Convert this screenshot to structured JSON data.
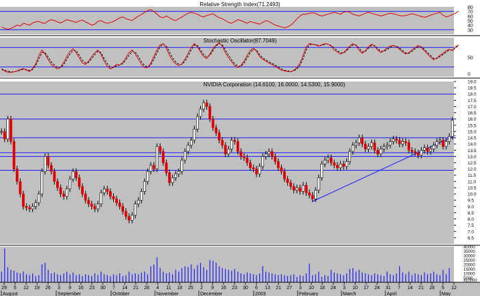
{
  "chart_data": [
    {
      "type": "line",
      "title": "Relative Strength Index(71.2493)",
      "ylim": [
        20,
        80
      ],
      "yticks": [
        30,
        40,
        50,
        60,
        70,
        80
      ],
      "hlines": [
        30,
        70
      ],
      "series": [
        {
          "values": [
            36,
            33,
            31,
            33,
            36,
            40,
            38,
            44,
            42,
            40,
            45,
            47,
            48,
            45,
            44,
            49,
            52,
            50,
            47,
            45,
            48,
            52,
            50,
            48,
            46,
            49,
            51,
            47,
            44,
            40,
            42,
            48,
            50,
            46,
            44,
            46,
            48,
            52,
            56,
            58,
            54,
            52,
            50,
            55,
            60,
            63,
            68,
            72,
            74,
            70,
            64,
            58,
            56,
            60,
            56,
            52,
            50,
            54,
            58,
            62,
            66,
            68,
            66,
            64,
            60,
            58,
            61,
            63,
            65,
            60,
            56,
            54,
            50,
            46,
            44,
            48,
            52,
            50,
            47,
            44,
            48,
            46,
            44,
            42,
            46,
            50,
            48,
            44,
            40,
            38,
            36,
            34,
            36,
            40,
            46,
            54,
            60,
            64,
            64,
            66,
            67,
            66,
            62,
            60,
            62,
            64,
            66,
            68,
            66,
            64,
            68,
            70,
            68,
            64,
            62,
            60,
            63,
            66,
            68,
            66,
            64,
            62,
            60,
            62,
            64,
            66,
            65,
            63,
            61,
            60,
            61,
            63,
            65,
            63,
            61,
            59,
            57,
            59,
            62,
            64,
            66,
            68,
            62,
            58,
            60,
            63,
            66,
            71
          ]
        }
      ]
    },
    {
      "type": "line",
      "title": "Stochastic Oscillator(87.7049)",
      "ylim": [
        -10,
        110
      ],
      "yticks": [
        0,
        50
      ],
      "hlines": [
        20,
        80
      ],
      "series": [
        {
          "values": [
            12,
            8,
            4,
            3,
            5,
            8,
            12,
            15,
            10,
            6,
            15,
            30,
            55,
            72,
            60,
            42,
            28,
            20,
            14,
            20,
            34,
            52,
            68,
            76,
            64,
            48,
            32,
            28,
            38,
            52,
            64,
            72,
            58,
            38,
            22,
            14,
            20,
            28,
            26,
            34,
            48,
            64,
            72,
            60,
            44,
            28,
            18,
            18,
            32,
            52,
            72,
            88,
            92,
            78,
            56,
            40,
            30,
            24,
            30,
            44,
            62,
            80,
            92,
            82,
            66,
            52,
            46,
            60,
            76,
            88,
            94,
            84,
            64,
            48,
            36,
            24,
            18,
            24,
            38,
            56,
            70,
            78,
            68,
            52,
            44,
            38,
            32,
            28,
            22,
            16,
            10,
            8,
            6,
            5,
            10,
            18,
            32,
            56,
            82,
            92,
            90,
            88,
            84,
            88,
            92,
            90,
            84,
            72,
            66,
            60,
            64,
            74,
            84,
            92,
            86,
            72,
            62,
            70,
            82,
            90,
            84,
            72,
            64,
            70,
            78,
            84,
            86,
            82,
            74,
            66,
            60,
            64,
            72,
            80,
            86,
            80,
            70,
            60,
            50,
            42,
            48,
            56,
            62,
            70,
            74,
            70,
            82,
            88
          ]
        },
        {
          "values": [
            14,
            10,
            7,
            5,
            5,
            7,
            10,
            13,
            12,
            9,
            12,
            25,
            45,
            64,
            64,
            50,
            36,
            26,
            18,
            18,
            28,
            44,
            60,
            72,
            70,
            56,
            40,
            32,
            34,
            46,
            58,
            68,
            64,
            46,
            30,
            20,
            18,
            24,
            26,
            30,
            42,
            56,
            68,
            66,
            52,
            36,
            24,
            20,
            26,
            44,
            64,
            82,
            90,
            84,
            66,
            48,
            36,
            28,
            28,
            38,
            54,
            72,
            88,
            86,
            72,
            58,
            50,
            56,
            70,
            84,
            92,
            88,
            72,
            56,
            42,
            30,
            22,
            22,
            32,
            48,
            64,
            74,
            72,
            58,
            48,
            42,
            36,
            31,
            26,
            20,
            14,
            10,
            8,
            6,
            8,
            14,
            26,
            46,
            72,
            88,
            90,
            89,
            86,
            86,
            90,
            90,
            86,
            78,
            70,
            64,
            63,
            70,
            80,
            88,
            88,
            78,
            66,
            68,
            78,
            86,
            86,
            76,
            68,
            68,
            74,
            80,
            85,
            84,
            78,
            70,
            63,
            62,
            68,
            76,
            82,
            82,
            74,
            64,
            55,
            46,
            46,
            52,
            58,
            66,
            72,
            72,
            78,
            86
          ]
        }
      ]
    },
    {
      "type": "candlestick",
      "title": "NVIDIA Corporation (14.6100, 16.0000, 14.5300, 15.9000)",
      "ylim": [
        6,
        19
      ],
      "yticks": [
        6.5,
        7.0,
        7.5,
        8.0,
        8.5,
        9.0,
        9.5,
        10.0,
        10.5,
        11.0,
        11.5,
        12.0,
        12.5,
        13.0,
        13.5,
        14.0,
        14.5,
        15.0,
        15.5,
        16.0,
        16.5,
        17.0,
        17.5,
        18.0,
        18.5,
        19.0
      ],
      "hlines": [
        18.0,
        16.0,
        14.5,
        13.3,
        13.0,
        11.9
      ],
      "trendline": {
        "x_start": 100,
        "y_start": 9.4,
        "x_end": 146,
        "y_end": 14.7
      },
      "close": [
        15.0,
        14.4,
        16.0,
        14.2,
        12.0,
        11.0,
        10.0,
        9.0,
        8.9,
        8.8,
        9.0,
        9.3,
        10.0,
        11.8,
        13.0,
        12.3,
        11.8,
        11.0,
        10.5,
        10.0,
        9.8,
        10.4,
        11.2,
        11.8,
        11.3,
        10.6,
        10.0,
        9.5,
        9.2,
        9.0,
        8.8,
        9.2,
        10.1,
        10.4,
        10.2,
        9.8,
        9.6,
        9.3,
        9.0,
        8.6,
        8.2,
        7.9,
        8.3,
        9.2,
        9.5,
        10.2,
        11.0,
        11.8,
        12.3,
        12.0,
        13.8,
        13.4,
        12.5,
        11.7,
        10.9,
        11.3,
        11.6,
        11.8,
        12.7,
        13.4,
        13.9,
        14.3,
        15.2,
        16.2,
        16.8,
        17.3,
        17.0,
        16.0,
        15.3,
        14.9,
        14.3,
        13.9,
        13.2,
        13.6,
        14.3,
        14.2,
        13.4,
        13.0,
        12.9,
        12.5,
        12.1,
        12.0,
        11.6,
        12.2,
        13.0,
        13.2,
        13.4,
        13.0,
        12.6,
        12.1,
        11.8,
        11.2,
        10.9,
        10.6,
        10.3,
        10.5,
        10.2,
        10.7,
        10.1,
        9.9,
        9.6,
        10.3,
        11.3,
        12.4,
        12.7,
        12.9,
        12.5,
        12.3,
        12.1,
        12.4,
        12.2,
        12.6,
        13.4,
        13.9,
        14.1,
        14.5,
        14.0,
        13.6,
        13.8,
        14.1,
        13.5,
        13.2,
        13.6,
        13.8,
        13.9,
        14.2,
        14.4,
        14.3,
        14.0,
        14.2,
        14.1,
        13.5,
        13.4,
        13.3,
        13.1,
        13.5,
        13.7,
        13.4,
        13.6,
        13.9,
        14.2,
        14.3,
        13.8,
        14.2,
        14.6,
        15.9
      ],
      "volume": [
        12000,
        38000,
        17000,
        14000,
        13000,
        11000,
        10000,
        12000,
        9000,
        8000,
        10000,
        7000,
        8000,
        20000,
        22000,
        14000,
        10000,
        11000,
        9000,
        8000,
        10000,
        12000,
        9000,
        11000,
        8000,
        9000,
        7000,
        9000,
        8000,
        7000,
        10000,
        8000,
        12000,
        9000,
        8000,
        7000,
        9000,
        8000,
        10000,
        7000,
        8000,
        12000,
        9000,
        10000,
        9000,
        11000,
        12000,
        9000,
        18000,
        20000,
        28000,
        16000,
        12000,
        10000,
        11000,
        9000,
        14000,
        12000,
        16000,
        18000,
        17000,
        20000,
        15000,
        19000,
        22000,
        17000,
        14000,
        25000,
        24000,
        22000,
        18000,
        16000,
        15000,
        14000,
        13000,
        15000,
        12000,
        10000,
        9000,
        11000,
        10000,
        9000,
        8000,
        10000,
        18000,
        12000,
        11000,
        10000,
        9000,
        8000,
        9000,
        8000,
        7000,
        8000,
        9000,
        6000,
        8000,
        7000,
        10000,
        21000,
        8000,
        9000,
        12000,
        6000,
        8000,
        7000,
        14000,
        11000,
        10000,
        9000,
        8000,
        10000,
        15000,
        16000,
        12000,
        14000,
        11000,
        10000,
        9000,
        8000,
        10000,
        9000,
        8000,
        7000,
        12000,
        9000,
        8000,
        10000,
        18000,
        11000,
        9000,
        12000,
        8000,
        10000,
        9000,
        8000,
        11000,
        9000,
        10000,
        12000,
        9000,
        8000,
        14000,
        9000,
        16000
      ],
      "volume_ticks": [
        5000,
        10000,
        15000,
        20000,
        25000,
        30000,
        35000,
        40000
      ],
      "volume_multiplier": "x10000",
      "x_day_labels": [
        "29",
        "5",
        "12",
        "19",
        "26",
        "3",
        "9",
        "16",
        "23",
        "30",
        "7",
        "14",
        "21",
        "28",
        "4",
        "11",
        "18",
        "25",
        "2",
        "9",
        "16",
        "23",
        "30",
        "6",
        "13",
        "21",
        "27",
        "3",
        "10",
        "18",
        "24",
        "3",
        "10",
        "17",
        "24",
        "31",
        "7",
        "14",
        "21",
        "28",
        "5",
        "12"
      ],
      "x_month_labels": [
        "August",
        "September",
        "October",
        "November",
        "December",
        "2003",
        "February",
        "March",
        "April",
        "May"
      ]
    }
  ]
}
